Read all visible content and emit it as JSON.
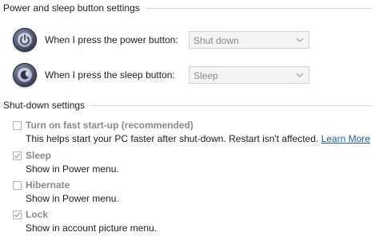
{
  "power_sleep_section": {
    "title": "Power and sleep button settings",
    "power_button": {
      "label": "When I press the power button:",
      "selected": "Shut down"
    },
    "sleep_button": {
      "label": "When I press the sleep button:",
      "selected": "Sleep"
    }
  },
  "shutdown_section": {
    "title": "Shut-down settings",
    "options": [
      {
        "title": "Turn on fast start-up (recommended)",
        "desc": "This helps start your PC faster after shut-down. Restart isn't affected.",
        "checked": false
      },
      {
        "title": "Sleep",
        "desc": "Show in Power menu.",
        "checked": true
      },
      {
        "title": "Hibernate",
        "desc": "Show in Power menu.",
        "checked": false
      },
      {
        "title": "Lock",
        "desc": "Show in account picture menu.",
        "checked": true
      }
    ],
    "learn_more": "Learn More"
  },
  "colors": {
    "link": "#1a5fb4",
    "disabled_text": "#8a8a8a",
    "divider": "#dcdcdc"
  }
}
